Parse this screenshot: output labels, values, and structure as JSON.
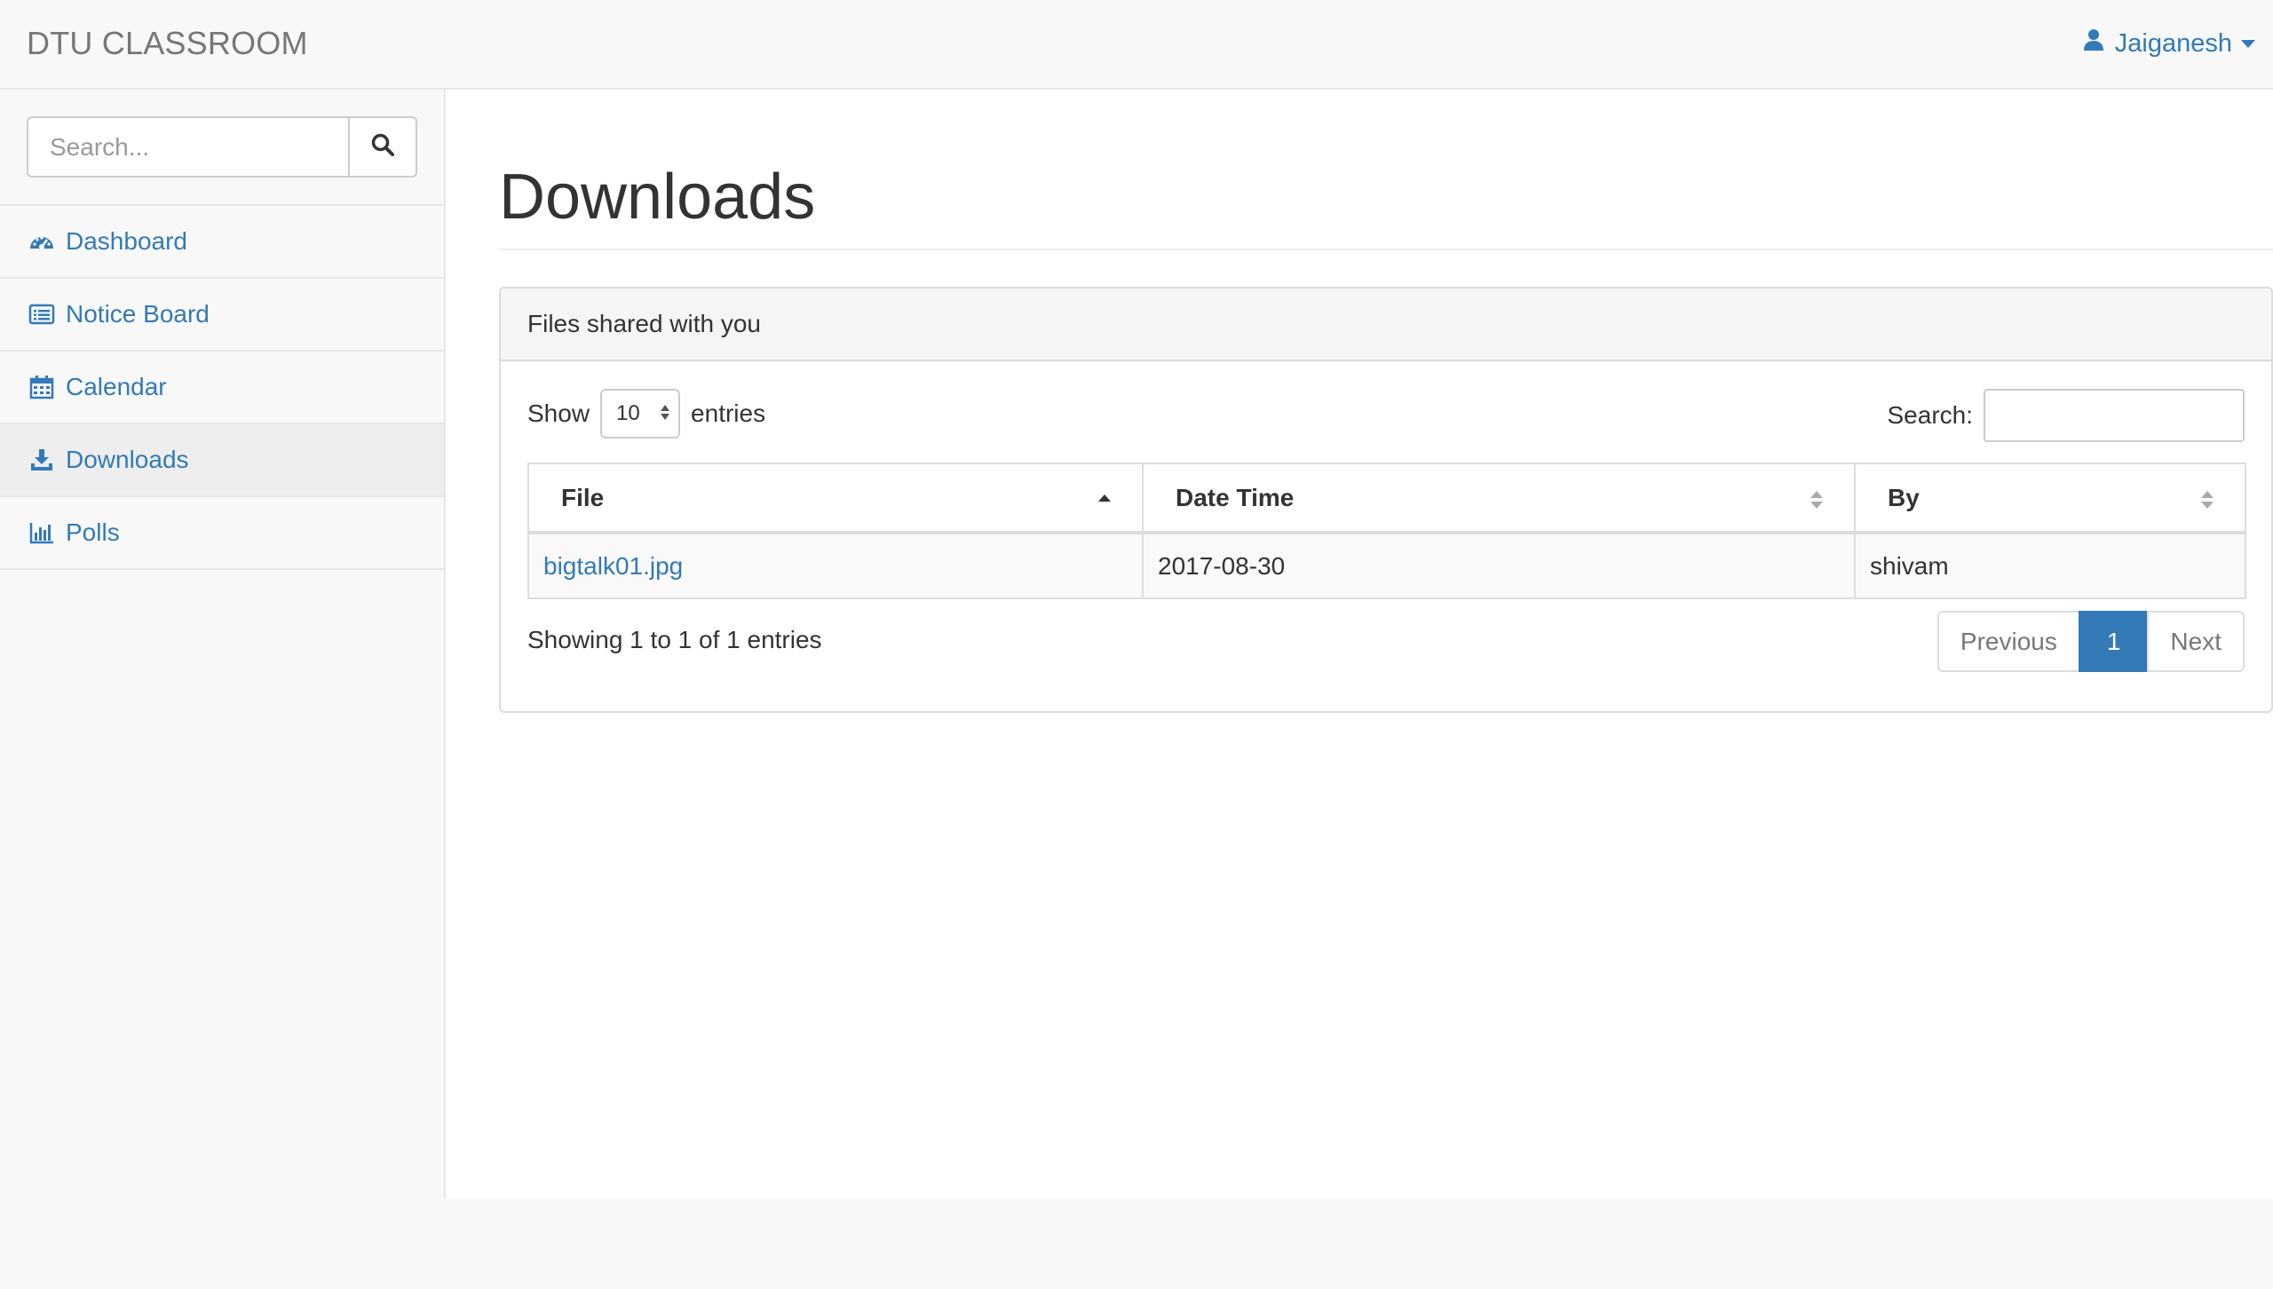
{
  "navbar": {
    "brand": "DTU CLASSROOM",
    "user_name": "Jaiganesh",
    "user_icon": "user-icon"
  },
  "sidebar": {
    "search": {
      "placeholder": "Search...",
      "button_icon": "search-icon"
    },
    "items": [
      {
        "label": "Dashboard",
        "icon": "dashboard-icon",
        "active": false
      },
      {
        "label": "Notice Board",
        "icon": "list-alt-icon",
        "active": false
      },
      {
        "label": "Calendar",
        "icon": "calendar-icon",
        "active": false
      },
      {
        "label": "Downloads",
        "icon": "download-icon",
        "active": true
      },
      {
        "label": "Polls",
        "icon": "bar-chart-icon",
        "active": false
      }
    ]
  },
  "main": {
    "title": "Downloads",
    "panel": {
      "heading": "Files shared with you",
      "length": {
        "show_label": "Show",
        "selected": "10",
        "entries_label": "entries"
      },
      "filter": {
        "label": "Search:",
        "value": ""
      },
      "table": {
        "columns": [
          "File",
          "Date Time",
          "By"
        ],
        "rows": [
          {
            "file": "bigtalk01.jpg",
            "date_time": "2017-08-30",
            "by": "shivam"
          }
        ]
      },
      "info": "Showing 1 to 1 of 1 entries",
      "pagination": {
        "previous": "Previous",
        "current": "1",
        "next": "Next"
      }
    }
  },
  "colors": {
    "link": "#337ab7",
    "navbar_bg": "#f8f8f8",
    "active_item_bg": "#eeeeee",
    "border": "#dddddd"
  }
}
